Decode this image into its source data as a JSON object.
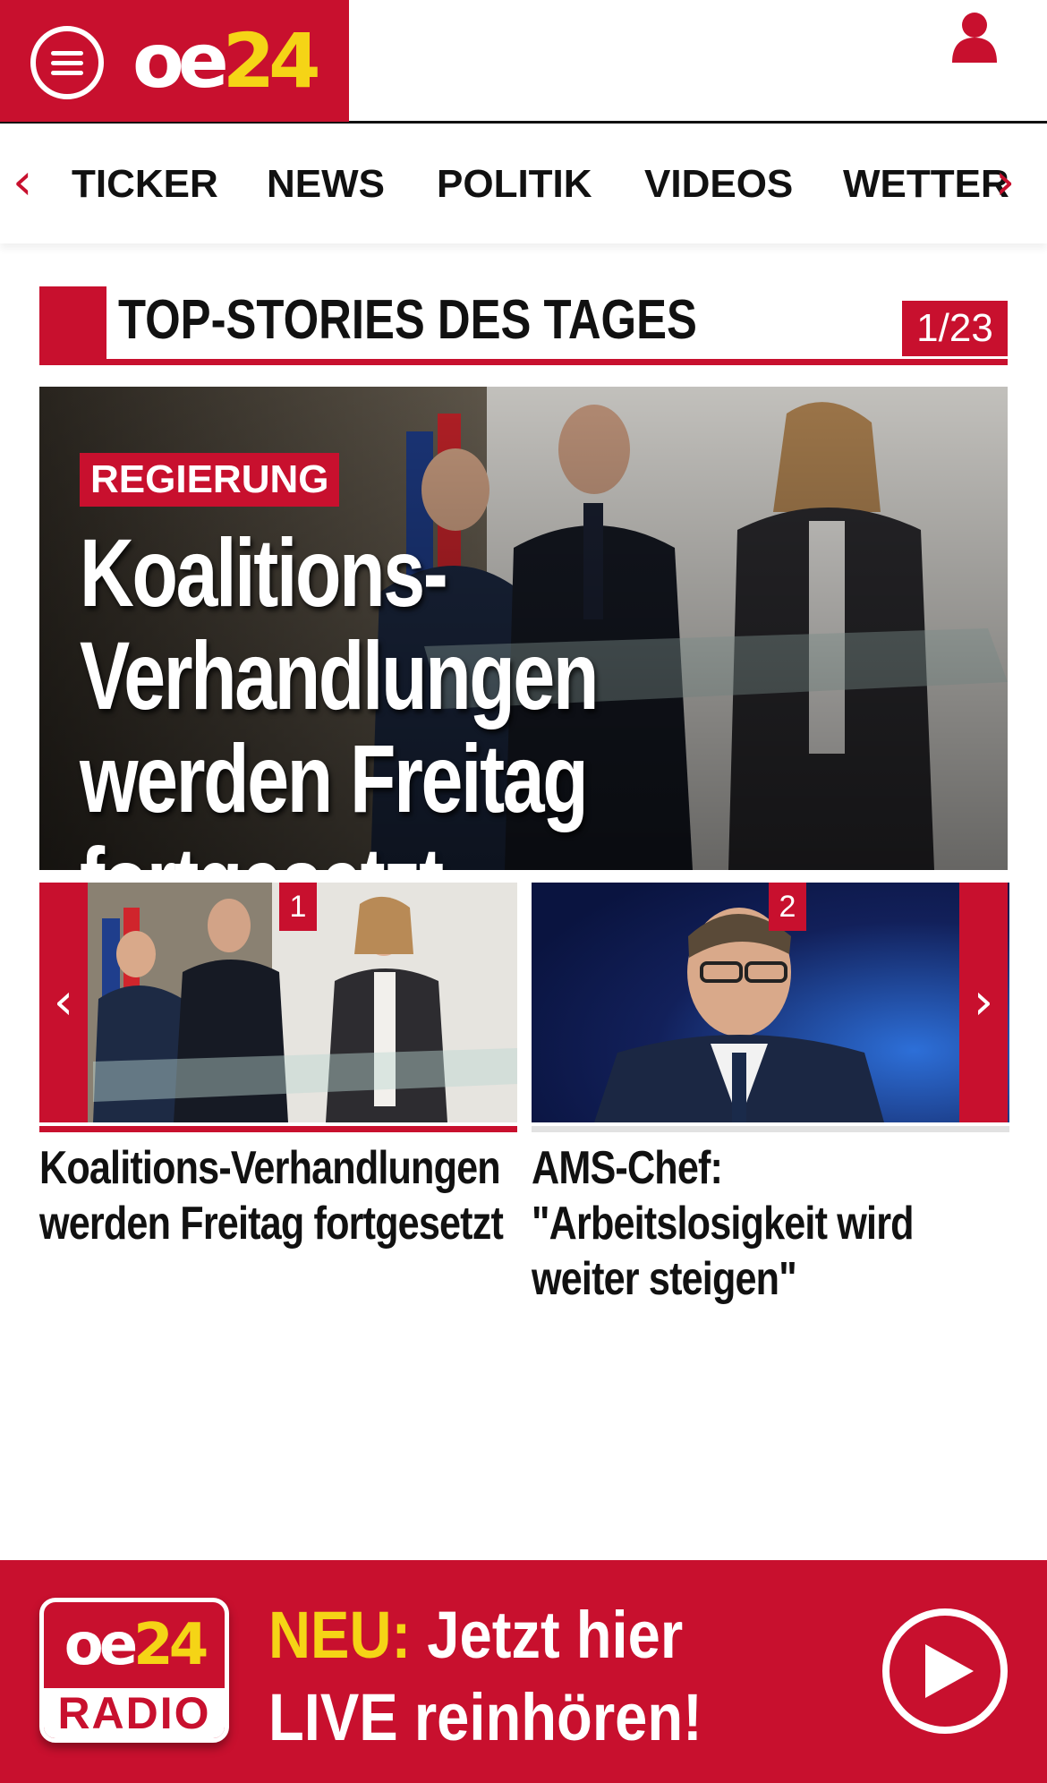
{
  "header": {
    "logo": {
      "oe": "oe",
      "num": "24"
    },
    "menu_icon": "hamburger-menu-icon",
    "user_icon": "user-icon"
  },
  "nav": {
    "prev_icon": "chevron-left-icon",
    "next_icon": "chevron-right-icon",
    "items": [
      {
        "label": "TICKER"
      },
      {
        "label": "NEWS"
      },
      {
        "label": "POLITIK"
      },
      {
        "label": "VIDEOS"
      },
      {
        "label": "WETTER"
      }
    ]
  },
  "section": {
    "title": "TOP-STORIES DES TAGES",
    "counter": "1/23"
  },
  "hero": {
    "kicker": "REGIERUNG",
    "headline_lines": [
      "Koalitions-",
      "Verhandlungen",
      "werden Freitag fortgesetzt"
    ]
  },
  "teasers": [
    {
      "number": "1",
      "title": "Koalitions-Verhandlungen werden Freitag fortgesetzt",
      "active": true
    },
    {
      "number": "2",
      "title": "AMS-Chef: \"Arbeitslosigkeit wird weiter steigen\"",
      "active": false
    }
  ],
  "radio_banner": {
    "logo_oe": "oe",
    "logo_num": "24",
    "logo_radio": "RADIO",
    "neu": "NEU:",
    "line1_rest": " Jetzt hier",
    "line2": "LIVE reinhören!",
    "play_icon": "play-icon"
  },
  "colors": {
    "brand_red": "#c8102e",
    "logo_yellow": "#f5d416",
    "text_dark": "#111111",
    "background": "#ffffff"
  }
}
